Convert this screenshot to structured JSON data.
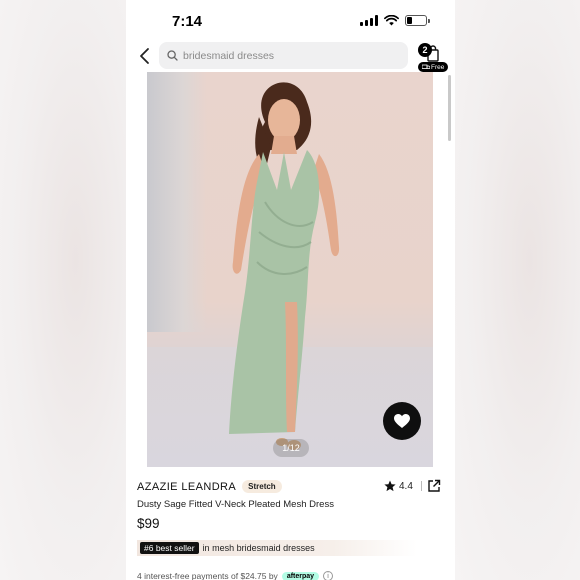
{
  "status_bar": {
    "time": "7:14"
  },
  "search": {
    "placeholder": "bridesmaid dresses"
  },
  "cart": {
    "count": "2",
    "free_label": "Free"
  },
  "gallery": {
    "counter": "1/12"
  },
  "product": {
    "brand": "AZAZIE LEANDRA",
    "badge": "Stretch",
    "rating": "4.4",
    "title": "Dusty Sage Fitted V-Neck Pleated Mesh Dress",
    "price": "$99"
  },
  "bestseller": {
    "tag": "#6 best seller",
    "text": "in mesh bridesmaid dresses"
  },
  "afterpay": {
    "text": "4 interest-free payments of $24.75 by",
    "logo": "afterpay",
    "info": "i"
  },
  "colors": {
    "dress": "#a9c3a6",
    "accent": "#000000",
    "afterpay": "#b2fce4"
  },
  "icons": [
    "back-arrow-icon",
    "search-icon",
    "cart-bag-icon",
    "heart-icon",
    "star-icon",
    "share-icon"
  ]
}
